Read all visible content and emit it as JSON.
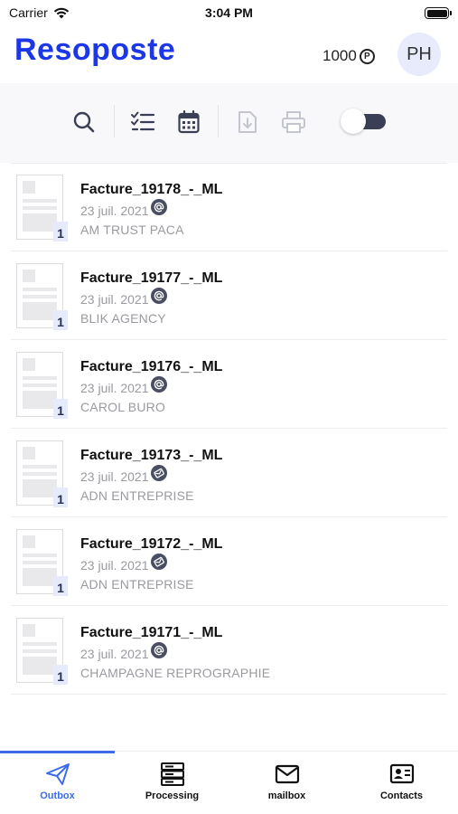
{
  "status_bar": {
    "carrier": "Carrier",
    "time": "3:04 PM"
  },
  "header": {
    "app_name": "Resoposte",
    "credits": "1000",
    "credit_symbol": "P",
    "user_initials": "PH"
  },
  "toolbar": {
    "icons": [
      "search-icon",
      "checklist-icon",
      "calendar-icon",
      "download-icon",
      "print-icon",
      "toggle-switch"
    ],
    "accent_color": "#1b37e8"
  },
  "documents": [
    {
      "title": "Facture_19178_-_ML",
      "date": "23 juil. 2021",
      "company": "AM TRUST PACA",
      "pages": "1",
      "status_icon": "at-icon"
    },
    {
      "title": "Facture_19177_-_ML",
      "date": "23 juil. 2021",
      "company": "BLIK AGENCY",
      "pages": "1",
      "status_icon": "at-icon"
    },
    {
      "title": "Facture_19176_-_ML",
      "date": "23 juil. 2021",
      "company": "CAROL BURO",
      "pages": "1",
      "status_icon": "at-icon"
    },
    {
      "title": "Facture_19173_-_ML",
      "date": "23 juil. 2021",
      "company": "ADN ENTREPRISE",
      "pages": "1",
      "status_icon": "envelope-check-icon"
    },
    {
      "title": "Facture_19172_-_ML",
      "date": "23 juil. 2021",
      "company": "ADN ENTREPRISE",
      "pages": "1",
      "status_icon": "envelope-check-icon"
    },
    {
      "title": "Facture_19171_-_ML",
      "date": "23 juil. 2021",
      "company": "CHAMPAGNE REPROGRAPHIE",
      "pages": "1",
      "status_icon": "at-icon"
    }
  ],
  "bottom_nav": {
    "items": [
      {
        "label": "Outbox",
        "icon": "paper-plane-icon",
        "active": true
      },
      {
        "label": "Processing",
        "icon": "server-stack-icon",
        "active": false
      },
      {
        "label": "mailbox",
        "icon": "envelope-icon",
        "active": false
      },
      {
        "label": "Contacts",
        "icon": "contact-card-icon",
        "active": false
      }
    ],
    "active_color": "#3d6be8"
  }
}
